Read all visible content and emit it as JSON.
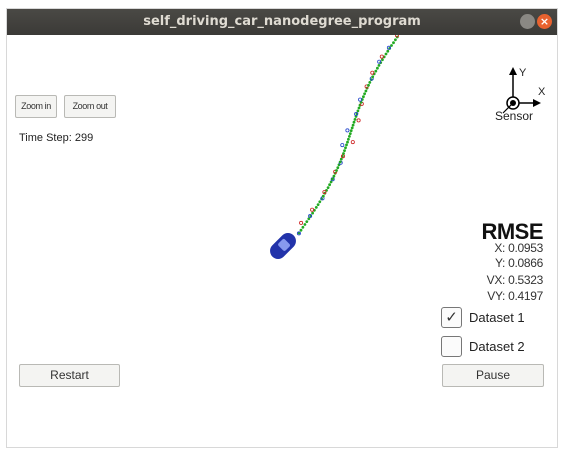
{
  "window": {
    "title": "self_driving_car_nanodegree_program"
  },
  "controls": {
    "zoom_in": "Zoom in",
    "zoom_out": "Zoom out",
    "restart": "Restart",
    "pause": "Pause"
  },
  "status": {
    "time_step": "Time Step: 299"
  },
  "axes_icon": {
    "y_label": "Y",
    "x_label": "X",
    "sensor_label": "Sensor"
  },
  "rmse": {
    "title": "RMSE",
    "x": "X: 0.0953",
    "y": "Y: 0.0866",
    "vx": "VX: 0.5323",
    "vy": "VY: 0.4197"
  },
  "datasets": [
    {
      "label": "Dataset 1",
      "checked": true
    },
    {
      "label": "Dataset 2",
      "checked": false
    }
  ],
  "colors": {
    "car": "#2233aa",
    "estimate": "#22aa22",
    "lidar": "#cc2222",
    "radar": "#2244cc"
  }
}
